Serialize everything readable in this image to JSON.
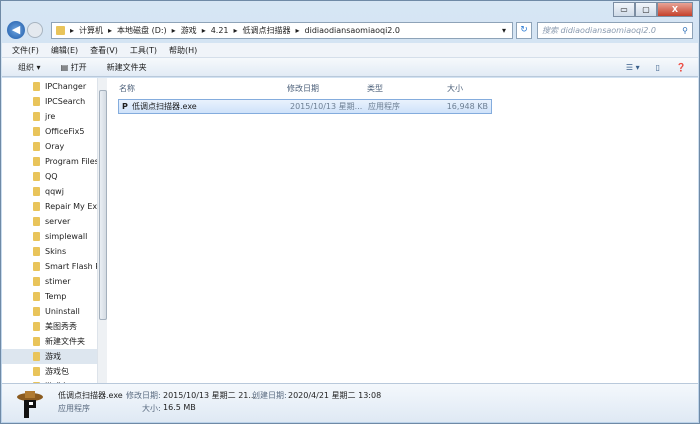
{
  "window": {
    "minimize": "▭",
    "maximize": "▢",
    "close": "X"
  },
  "breadcrumb": [
    "计算机",
    "本地磁盘 (D:)",
    "游戏",
    "4.21",
    "低调点扫描器",
    "didiaodiansaomiaoqi2.0"
  ],
  "search": {
    "placeholder": "搜索 didiaodiansaomiaoqi2.0"
  },
  "menu": [
    "文件(F)",
    "编辑(E)",
    "查看(V)",
    "工具(T)",
    "帮助(H)"
  ],
  "toolbar": {
    "organize": "组织 ▾",
    "open": "打开",
    "new_folder": "新建文件夹"
  },
  "sidebar": {
    "items": [
      "IPChanger",
      "IPCSearch",
      "jre",
      "OfficeFix5",
      "Oray",
      "Program Files",
      "QQ",
      "qqwj",
      "Repair My Exe",
      "server",
      "simplewall",
      "Skins",
      "Smart Flash R",
      "stimer",
      "Temp",
      "Uninstall",
      "美图秀秀",
      "新建文件夹",
      "游戏",
      "游戏包",
      "游戏台"
    ],
    "selected": "游戏"
  },
  "columns": [
    "名称",
    "修改日期",
    "类型",
    "大小"
  ],
  "files": [
    {
      "name": "低调点扫描器.exe",
      "modified": "2015/10/13 星期...",
      "type": "应用程序",
      "size": "16,948 KB"
    }
  ],
  "details": {
    "name": "低调点扫描器.exe",
    "type": "应用程序",
    "modified_label": "修改日期:",
    "modified": "2015/10/13 星期二 21...",
    "created_label": "创建日期:",
    "created": "2020/4/21 星期二 13:08",
    "size_label": "大小:",
    "size": "16.5 MB"
  }
}
